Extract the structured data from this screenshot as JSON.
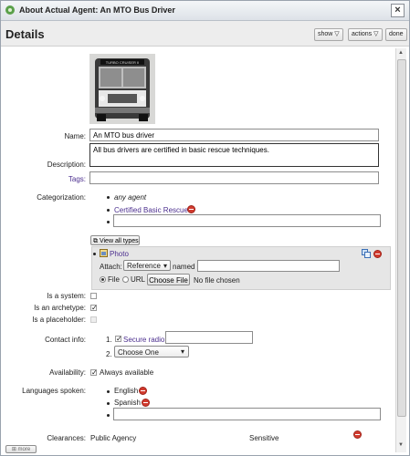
{
  "window": {
    "title": "About Actual Agent: An MTO Bus Driver"
  },
  "header": {
    "title": "Details",
    "show_label": "show",
    "actions_label": "actions",
    "done_label": "done"
  },
  "photo_sign": "TURBO CRUISER II",
  "form": {
    "name_label": "Name:",
    "name_value": "An MTO bus driver",
    "description_label": "Description:",
    "description_value": "All bus drivers are certified in basic rescue techniques.",
    "tags_label": "Tags:",
    "categorization_label": "Categorization:",
    "categories": [
      "any agent",
      "Certified Basic Rescue"
    ],
    "view_all_types": "View all types",
    "photo": {
      "label": "Photo",
      "attach_label": "Attach:",
      "attach_value": "Reference",
      "named_label": "named",
      "file_label": "File",
      "url_label": "URL",
      "choose_file": "Choose File",
      "no_file": "No file chosen"
    },
    "is_system_label": "Is a system:",
    "is_archetype_label": "Is an archetype:",
    "is_placeholder_label": "Is a placeholder:",
    "contact_label": "Contact info:",
    "contact": [
      {
        "num": "1.",
        "label": "Secure radio"
      },
      {
        "num": "2.",
        "label": "Choose One"
      }
    ],
    "availability_label": "Availability:",
    "availability_value": "Always available",
    "languages_label": "Languages spoken:",
    "languages": [
      "English",
      "Spanish"
    ],
    "clearances_label": "Clearances:",
    "clearance_value": "Public Agency",
    "clearance_level": "Sensitive",
    "more_label": "more"
  }
}
